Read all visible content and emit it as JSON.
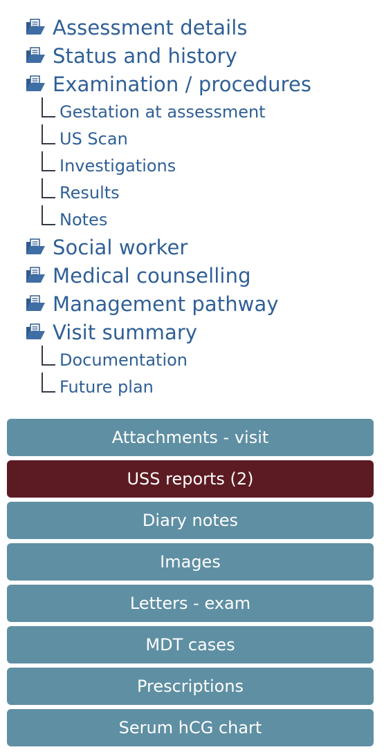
{
  "tree": {
    "sections": [
      {
        "label": "Assessment details",
        "icon": "folder-document-icon"
      },
      {
        "label": "Status and history",
        "icon": "folder-document-icon"
      },
      {
        "label": "Examination / procedures",
        "icon": "folder-document-icon",
        "children": [
          "Gestation at assessment",
          "US Scan",
          "Investigations",
          "Results",
          "Notes"
        ]
      },
      {
        "label": "Social worker",
        "icon": "folder-document-icon"
      },
      {
        "label": "Medical counselling",
        "icon": "folder-document-icon"
      },
      {
        "label": "Management pathway",
        "icon": "folder-document-icon"
      },
      {
        "label": "Visit summary",
        "icon": "folder-document-icon",
        "children": [
          "Documentation",
          "Future plan"
        ]
      }
    ]
  },
  "buttons": [
    {
      "label": "Attachments - visit",
      "active": false
    },
    {
      "label": "USS reports (2)",
      "active": true
    },
    {
      "label": "Diary notes",
      "active": false
    },
    {
      "label": "Images",
      "active": false
    },
    {
      "label": "Letters - exam",
      "active": false
    },
    {
      "label": "MDT cases",
      "active": false
    },
    {
      "label": "Prescriptions",
      "active": false
    },
    {
      "label": "Serum hCG chart",
      "active": false
    }
  ],
  "colors": {
    "link": "#2f5f96",
    "button": "#5f8fa3",
    "button_active": "#5c1b22",
    "connector": "#333a45"
  }
}
